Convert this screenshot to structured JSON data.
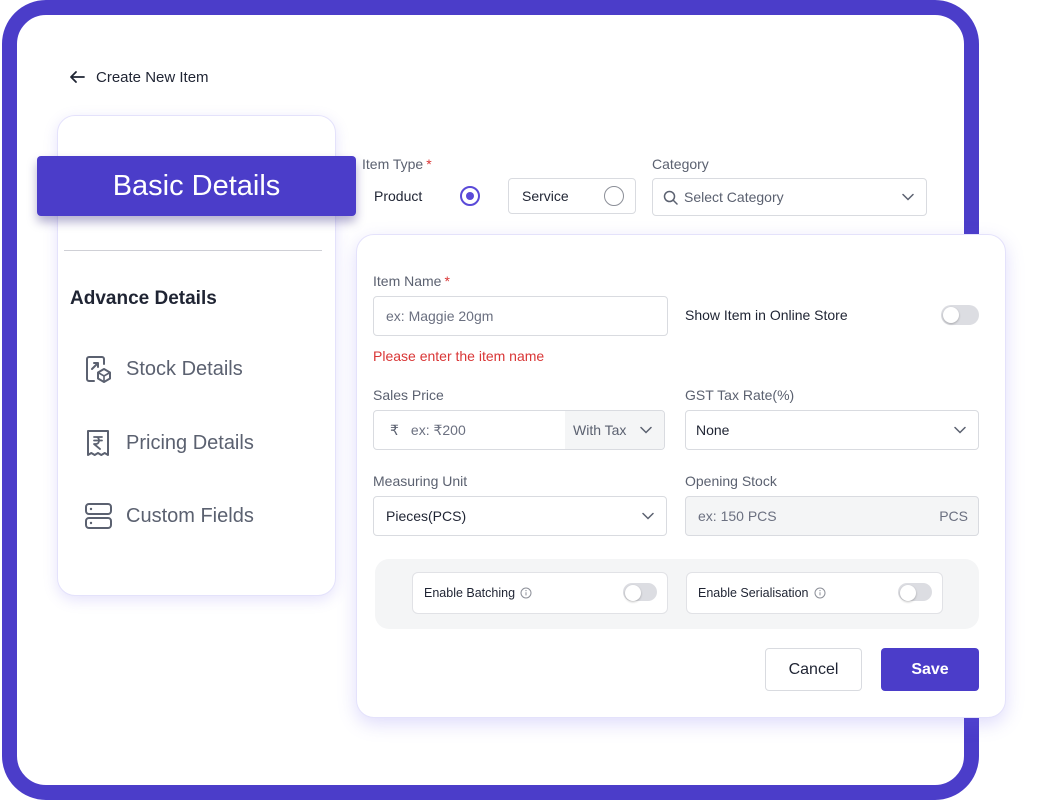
{
  "header": {
    "back_label": "Create New Item"
  },
  "sidebar": {
    "active_tab": "Basic Details",
    "section_title": "Advance Details",
    "items": [
      {
        "label": "Stock Details",
        "icon": "stock-box-icon"
      },
      {
        "label": "Pricing Details",
        "icon": "rupee-receipt-icon"
      },
      {
        "label": "Custom Fields",
        "icon": "server-stack-icon"
      }
    ]
  },
  "item_type": {
    "label": "Item Type",
    "required_mark": "*",
    "options": [
      {
        "label": "Product",
        "selected": true
      },
      {
        "label": "Service",
        "selected": false
      }
    ]
  },
  "category": {
    "label": "Category",
    "placeholder": "Select Category"
  },
  "form": {
    "item_name": {
      "label": "Item Name",
      "required_mark": "*",
      "placeholder": "ex: Maggie 20gm",
      "error": "Please enter the item name"
    },
    "online_store": {
      "label": "Show Item in Online Store",
      "enabled": false
    },
    "sales_price": {
      "label": "Sales Price",
      "currency_symbol": "₹",
      "placeholder": "ex: ₹200",
      "tax_mode": "With Tax"
    },
    "gst_rate": {
      "label": "GST Tax Rate(%)",
      "value": "None"
    },
    "measuring_unit": {
      "label": "Measuring Unit",
      "value": "Pieces(PCS)"
    },
    "opening_stock": {
      "label": "Opening Stock",
      "placeholder": "ex: 150 PCS",
      "unit": "PCS"
    },
    "batching": {
      "label": "Enable Batching",
      "enabled": false
    },
    "serialisation": {
      "label": "Enable Serialisation",
      "enabled": false
    }
  },
  "actions": {
    "cancel_label": "Cancel",
    "save_label": "Save"
  },
  "colors": {
    "brand": "#4b3dc9",
    "error": "#d93636"
  }
}
